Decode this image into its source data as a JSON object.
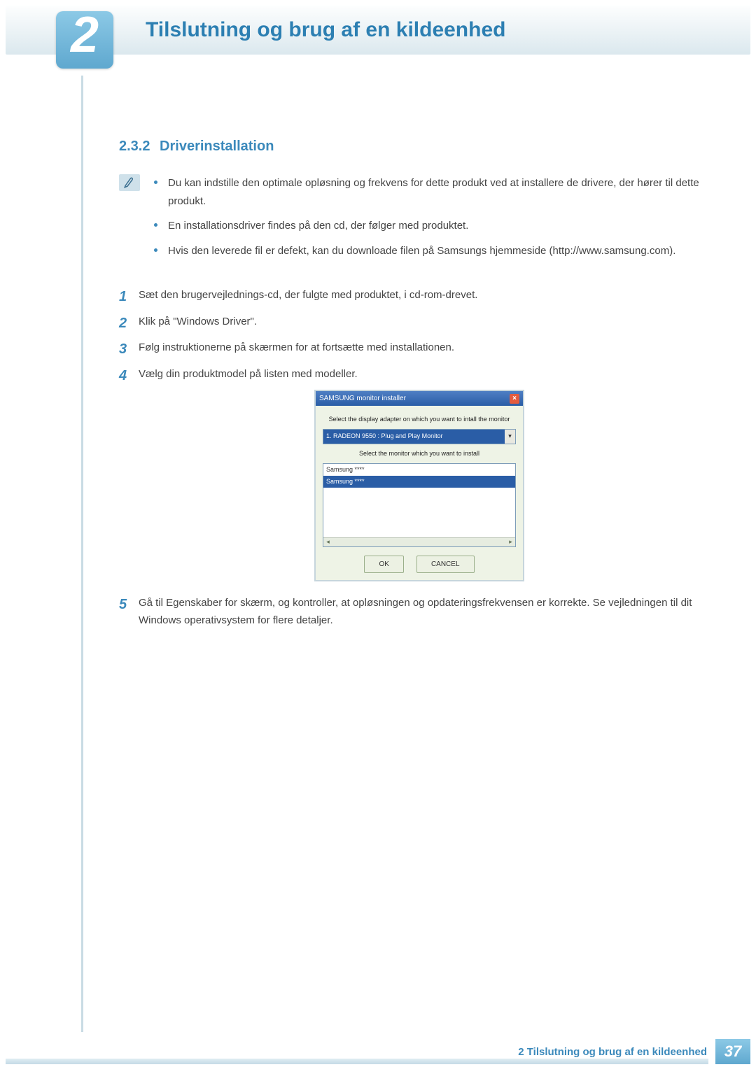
{
  "header": {
    "chapter_number": "2",
    "title": "Tilslutning og brug af en kildeenhed"
  },
  "section": {
    "number": "2.3.2",
    "title": "Driverinstallation"
  },
  "notes": [
    "Du kan indstille den optimale opløsning og frekvens for dette produkt ved at installere de drivere, der hører til dette produkt.",
    "En installationsdriver findes på den cd, der følger med produktet.",
    "Hvis den leverede fil er defekt, kan du downloade filen på Samsungs hjemmeside (http://www.samsung.com)."
  ],
  "steps": {
    "s1": {
      "num": "1",
      "text": "Sæt den brugervejlednings-cd, der fulgte med produktet, i cd-rom-drevet."
    },
    "s2": {
      "num": "2",
      "text": "Klik på \"Windows Driver\"."
    },
    "s3": {
      "num": "3",
      "text": "Følg instruktionerne på skærmen for at fortsætte med installationen."
    },
    "s4": {
      "num": "4",
      "text": "Vælg din produktmodel på listen med modeller."
    },
    "s5": {
      "num": "5",
      "text": "Gå til Egenskaber for skærm, og kontroller, at opløsningen og opdateringsfrekvensen er korrekte. Se vejledningen til dit Windows operativsystem for flere detaljer."
    }
  },
  "screenshot": {
    "window_title": "SAMSUNG monitor installer",
    "close_glyph": "×",
    "label_adapter": "Select the display adapter on which you want to intall the monitor",
    "dropdown_selected": "1. RADEON 9550 : Plug and Play Monitor",
    "label_monitor": "Select the monitor which you want to install",
    "list_item1": "Samsung ****",
    "list_item2": "Samsung ****",
    "btn_ok": "OK",
    "btn_cancel": "CANCEL"
  },
  "footer": {
    "label": "2 Tilslutning og brug af en kildeenhed",
    "page_number": "37"
  }
}
